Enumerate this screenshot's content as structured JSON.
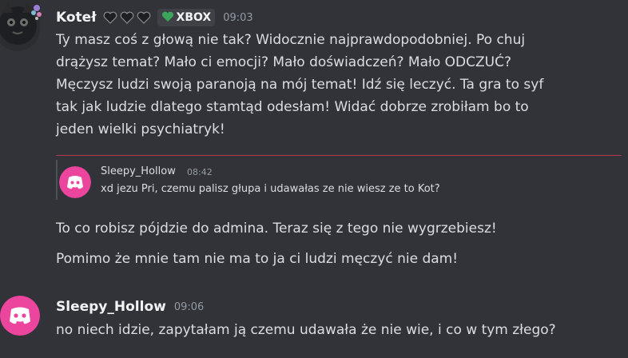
{
  "message1": {
    "author": "Koteł",
    "hearts": [
      "black-heart-icon",
      "black-heart-icon",
      "black-heart-icon"
    ],
    "tag_icon": "green-heart-icon",
    "tag_label": "XBOX",
    "time": "09:03",
    "lines": [
      "Ty masz coś z głową nie tak? Widocznie najprawdopodobniej. Po chuj",
      "drążysz temat? Mało ci emocji? Mało doświadczeń? Mało ODCZUĆ?",
      "Męczysz ludzi swoją paranoją na mój temat! Idź się leczyć. Ta gra to syf",
      "tak jak ludzie dlatego stamtąd odesłam! Widać dobrze zrobiłam bo to",
      "jeden wielki psychiatryk!"
    ]
  },
  "reply": {
    "author": "Sleepy_Hollow",
    "time": "08:42",
    "text": "xd jezu Pri, czemu palisz głupa i udawałas ze nie wiesz ze to Kot?"
  },
  "message1_continued": {
    "line1": "To co robisz pójdzie do admina. Teraz się z tego nie wygrzebiesz!",
    "line2": "Pomimo że mnie tam nie ma to ja ci ludzi męczyć nie dam!"
  },
  "message2": {
    "author": "Sleepy_Hollow",
    "time": "09:06",
    "text": "no niech idzie, zapytałam ją czemu udawała że nie wie, i co w tym złego?"
  },
  "colors": {
    "background": "#313338",
    "discord_pink": "#eb459e",
    "divider": "#b13a4b",
    "tag_green": "#3ba55d"
  }
}
